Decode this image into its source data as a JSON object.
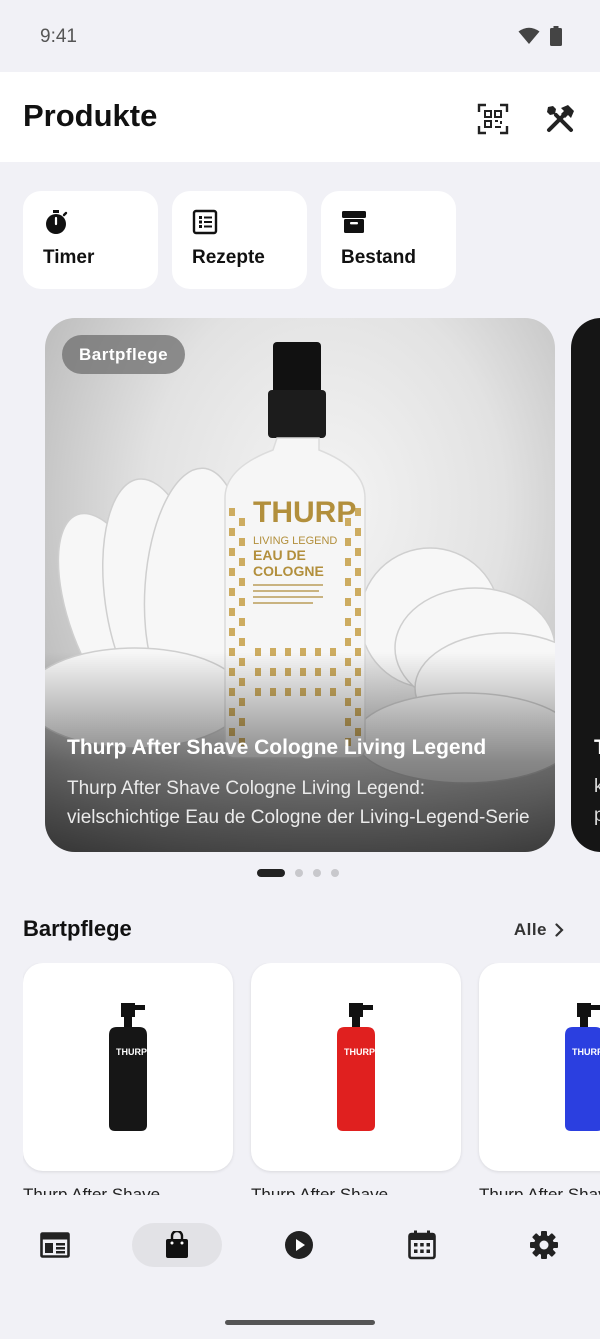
{
  "status_bar": {
    "time": "9:41"
  },
  "header": {
    "title": "Produkte",
    "icons": [
      "qr-code-scanner-icon",
      "tools-icon"
    ]
  },
  "quick_actions": [
    {
      "label": "Timer",
      "icon": "stopwatch-icon"
    },
    {
      "label": "Rezepte",
      "icon": "list-icon"
    },
    {
      "label": "Bestand",
      "icon": "archive-box-icon"
    }
  ],
  "hero": {
    "badge": "Bartpflege",
    "title": "Thurp After Shave Cologne Living Legend",
    "description": "Thurp After Shave Cologne Living Legend: vielschichtige Eau de Cologne der Living-Legend-Serie",
    "label": {
      "brand": "THURP",
      "line1": "LIVING LEGEND",
      "line2": "EAU DE",
      "line3": "COLOGNE"
    },
    "next_peek": {
      "title": "T",
      "line1": "k",
      "line2": "p"
    },
    "pager": {
      "count": 4,
      "active_index": 0
    }
  },
  "section": {
    "title": "Bartpflege",
    "link_label": "Alle"
  },
  "products": [
    {
      "name": "Thurp After Shave",
      "bottle_color": "#161616",
      "label": "THURP"
    },
    {
      "name": "Thurp After Shave",
      "bottle_color": "#e0201f",
      "label": "THURP"
    },
    {
      "name": "Thurp After Shave",
      "bottle_color": "#2b3fe0",
      "label": "THURP"
    }
  ],
  "bottom_nav": [
    {
      "icon": "newspaper-icon",
      "active": false
    },
    {
      "icon": "shopping-bag-icon",
      "active": true
    },
    {
      "icon": "play-circle-icon",
      "active": false
    },
    {
      "icon": "calendar-icon",
      "active": false
    },
    {
      "icon": "gear-icon",
      "active": false
    }
  ],
  "colors": {
    "background": "#f1f1f6",
    "surface": "#ffffff",
    "text": "#111111",
    "nav_active": "#e2e2e6",
    "accent_gold": "#c9a550"
  }
}
